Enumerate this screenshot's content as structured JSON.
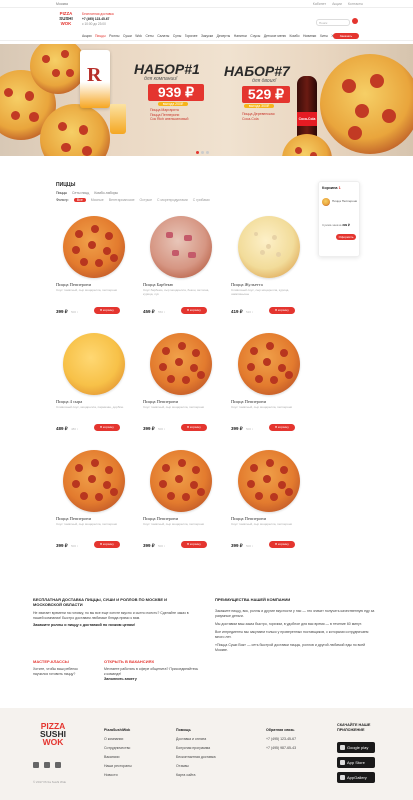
{
  "topbar": {
    "city": "Москва",
    "links": [
      "Кабинет",
      "Акции",
      "Контакты"
    ]
  },
  "header": {
    "logo": [
      "PIZZA",
      "SUSHI",
      "WOK"
    ],
    "delivery": "Бесплатная доставка",
    "phone": "+7 (495) 123-45-67",
    "hours": "с 10:00 до 23:00",
    "search_placeholder": "Поиск"
  },
  "nav": {
    "items": [
      "Акции",
      "Пиццы",
      "Роллы",
      "Суши",
      "Wok",
      "Сеты",
      "Салаты",
      "Супы",
      "Горячее",
      "Закуски",
      "Десерты",
      "Напитки",
      "Соусы",
      "Детское меню",
      "Комбо",
      "Новинки",
      "Хиты",
      "Хиты Роллы"
    ],
    "active": 1,
    "button": "Заказать"
  },
  "banner": {
    "left": {
      "title": "НАБОР",
      "num": "#1",
      "sub": "для компании!",
      "price": "939 ₽",
      "badge": "выгода 200₽",
      "items": [
        "Пицца Маргарита",
        "Пицца Пепперони",
        "Сок Rich апельсиновый"
      ]
    },
    "right": {
      "title": "НАБОР",
      "num": "#7",
      "sub": "для двоих!",
      "price": "529 ₽",
      "badge": "выгода 300₽",
      "items": [
        "Пицца Деревенская",
        "Coca-Cola"
      ]
    },
    "juice_letter": "R",
    "cola_label": "Coca-Cola"
  },
  "section": {
    "title": "ПИЦЦЫ",
    "sublinks": [
      "Пиццы",
      "Сеты пицц",
      "Комбо-наборы"
    ],
    "filter_label": "Фильтр:",
    "filters": [
      "Все",
      "Мясные",
      "Вегетарианские",
      "Острые",
      "С морепродуктами",
      "С грибами"
    ],
    "active_filter": 0
  },
  "cart": {
    "title": "Корзина",
    "count": "1",
    "item": "Пицца Пепперони",
    "sum_label": "Сумма заказа",
    "sum": "399 ₽",
    "button": "Оформить"
  },
  "cards": [
    {
      "name": "Пицца Пепперони",
      "desc": "Соус томатный, сыр моцарелла, пепперони",
      "price": "399 ₽",
      "weight": "500 г",
      "button": "В корзину"
    },
    {
      "name": "Пицца Барбекю",
      "desc": "Соус барбекю, сыр моцарелла, бекон, ветчина, курица, лук",
      "price": "459 ₽",
      "weight": "550 г",
      "button": "В корзину"
    },
    {
      "name": "Пицца Жульетта",
      "desc": "Сливочный соус, сыр моцарелла, курица, шампиньоны",
      "price": "419 ₽",
      "weight": "520 г",
      "button": "В корзину"
    },
    {
      "name": "Пицца 4 сыра",
      "desc": "Сливочный соус, моцарелла, пармезан, дорблю",
      "price": "489 ₽",
      "weight": "480 г",
      "button": "В корзину"
    },
    {
      "name": "Пицца Пепперони",
      "desc": "Соус томатный, сыр моцарелла, пепперони",
      "price": "399 ₽",
      "weight": "500 г",
      "button": "В корзину"
    },
    {
      "name": "Пицца Пепперони",
      "desc": "Соус томатный, сыр моцарелла, пепперони",
      "price": "399 ₽",
      "weight": "500 г",
      "button": "В корзину"
    },
    {
      "name": "Пицца Пепперони",
      "desc": "Соус томатный, сыр моцарелла, пепперони",
      "price": "399 ₽",
      "weight": "500 г",
      "button": "В корзину"
    },
    {
      "name": "Пицца Пепперони",
      "desc": "Соус томатный, сыр моцарелла, пепперони",
      "price": "399 ₽",
      "weight": "500 г",
      "button": "В корзину"
    },
    {
      "name": "Пицца Пепперони",
      "desc": "Соус томатный, сыр моцарелла, пепперони",
      "price": "399 ₽",
      "weight": "500 г",
      "button": "В корзину"
    }
  ],
  "info": {
    "left_title": "БЕСПЛАТНАЯ ДОСТАВКА ПИЦЦЫ, СУШИ И РОЛЛОВ ПО МОСКВЕ И МОСКОВСКОЙ ОБЛАСТИ",
    "left_text": "Не хватает времени на готовку, но вы все еще хотите вкусно и сытно поесть? Сделайте заказ в нашей компании! Быстро доставим любимые блюда прямо к вам.",
    "left_bold": "Закажите роллы и пиццу с доставкой по низким ценам!",
    "vacancy_title": "МАСТЕР-КЛАССЫ",
    "vacancy_text": "Хотите, чтобы ваш ребенок научился готовить пиццу?",
    "open_title": "ОТКРЫТЬ В ВАКАНСИЯХ",
    "open_text": "Мечтаете работать в сфере общепита? Присоединяйтесь к команде!",
    "open_bold": "Заполнить анкету",
    "right_title": "ПРЕИМУЩЕСТВА НАШЕЙ КОМПАНИИ",
    "right_p1": "Закажите пиццу, вок, роллы и другие вкусности у нас — это значит получить качественную еду за разумные деньги.",
    "right_p2": "Мы доставим ваш заказ быстро, горячим, в удобное для вас время — в течение 60 минут.",
    "right_p3": "Все ингредиенты мы закупаем только у проверенных поставщиков, с которыми сотрудничаем много лет.",
    "right_p4": "«Пицца Суши Вок» — сеть быстрой доставки пиццы, роллов и другой любимой еды по всей Москве."
  },
  "footer": {
    "logo": [
      "PIZZA",
      "SUSHI",
      "WOK"
    ],
    "copyright": "© 2017 Pizza Sushi Wok",
    "col1": {
      "title": "PizzaSushiWok",
      "items": [
        "О компании",
        "Сотрудничество",
        "Вакансии",
        "Наши рестораны",
        "Новости"
      ]
    },
    "col2": {
      "title": "Помощь",
      "items": [
        "Доставка и оплата",
        "Бонусная программа",
        "Бесконтактная доставка",
        "Отзывы",
        "Карта сайта"
      ]
    },
    "col3": {
      "title": "Обратная связь",
      "items": [
        "+7 (495) 123-45-67",
        "+7 (495) 987-65-43"
      ]
    },
    "app_title": "СКАЧАЙТЕ НАШЕ ПРИЛОЖЕНИЕ",
    "stores": [
      "Google play",
      "App Store",
      "AppGallery"
    ]
  }
}
